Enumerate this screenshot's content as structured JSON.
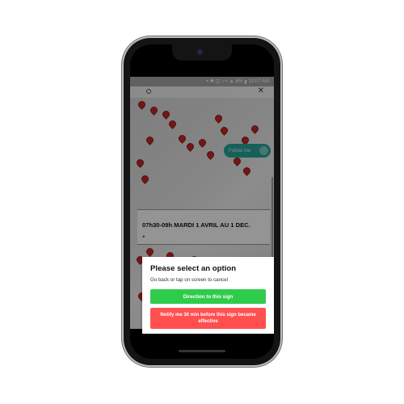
{
  "status_bar": {
    "time": "12:07 AM",
    "battery": "6%"
  },
  "info_card": {
    "title": "07h30-09h MARDI 1 AVRIL AU 1 DEC."
  },
  "follow_toggle": {
    "label": "Follow me"
  },
  "dialog": {
    "title": "Please select an option",
    "subtitle": "Go back or tap on screen to cancel",
    "primary_button": "Direction to this sign",
    "secondary_button": "Notify me 30 min before this sign became effective"
  },
  "colors": {
    "primary_button": "#2ecc4a",
    "secondary_button": "#ff4f4f",
    "pin": "#c62828",
    "follow_toggle": "#26a69a"
  },
  "icons": [
    "search-icon",
    "close-icon",
    "map-pin-icon",
    "camera-icon"
  ]
}
